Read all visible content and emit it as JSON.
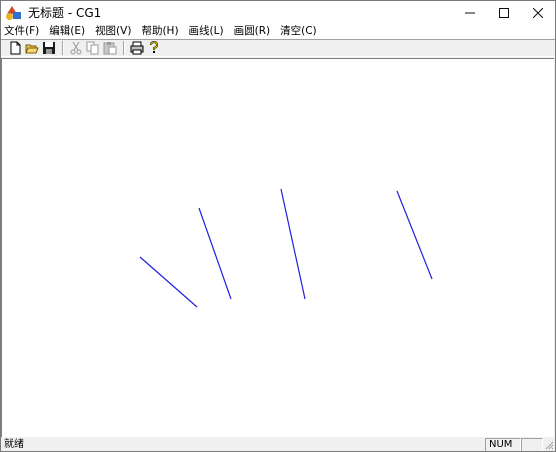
{
  "window": {
    "title": "无标题 - CG1",
    "controls": {
      "minimize": "—",
      "maximize": "☐",
      "close": "✕"
    }
  },
  "menubar": {
    "items": [
      {
        "label": "文件(F)"
      },
      {
        "label": "编辑(E)"
      },
      {
        "label": "视图(V)"
      },
      {
        "label": "帮助(H)"
      },
      {
        "label": "画线(L)"
      },
      {
        "label": "画圆(R)"
      },
      {
        "label": "清空(C)"
      }
    ]
  },
  "toolbar": {
    "buttons": [
      "new-file-icon",
      "open-folder-icon",
      "save-icon",
      "cut-icon",
      "copy-icon",
      "paste-icon",
      "print-icon",
      "help-icon"
    ]
  },
  "canvas": {
    "line_color": "#2020e0",
    "background": "#ffffff"
  },
  "statusbar": {
    "text": "就绪",
    "indicator": "NUM"
  }
}
